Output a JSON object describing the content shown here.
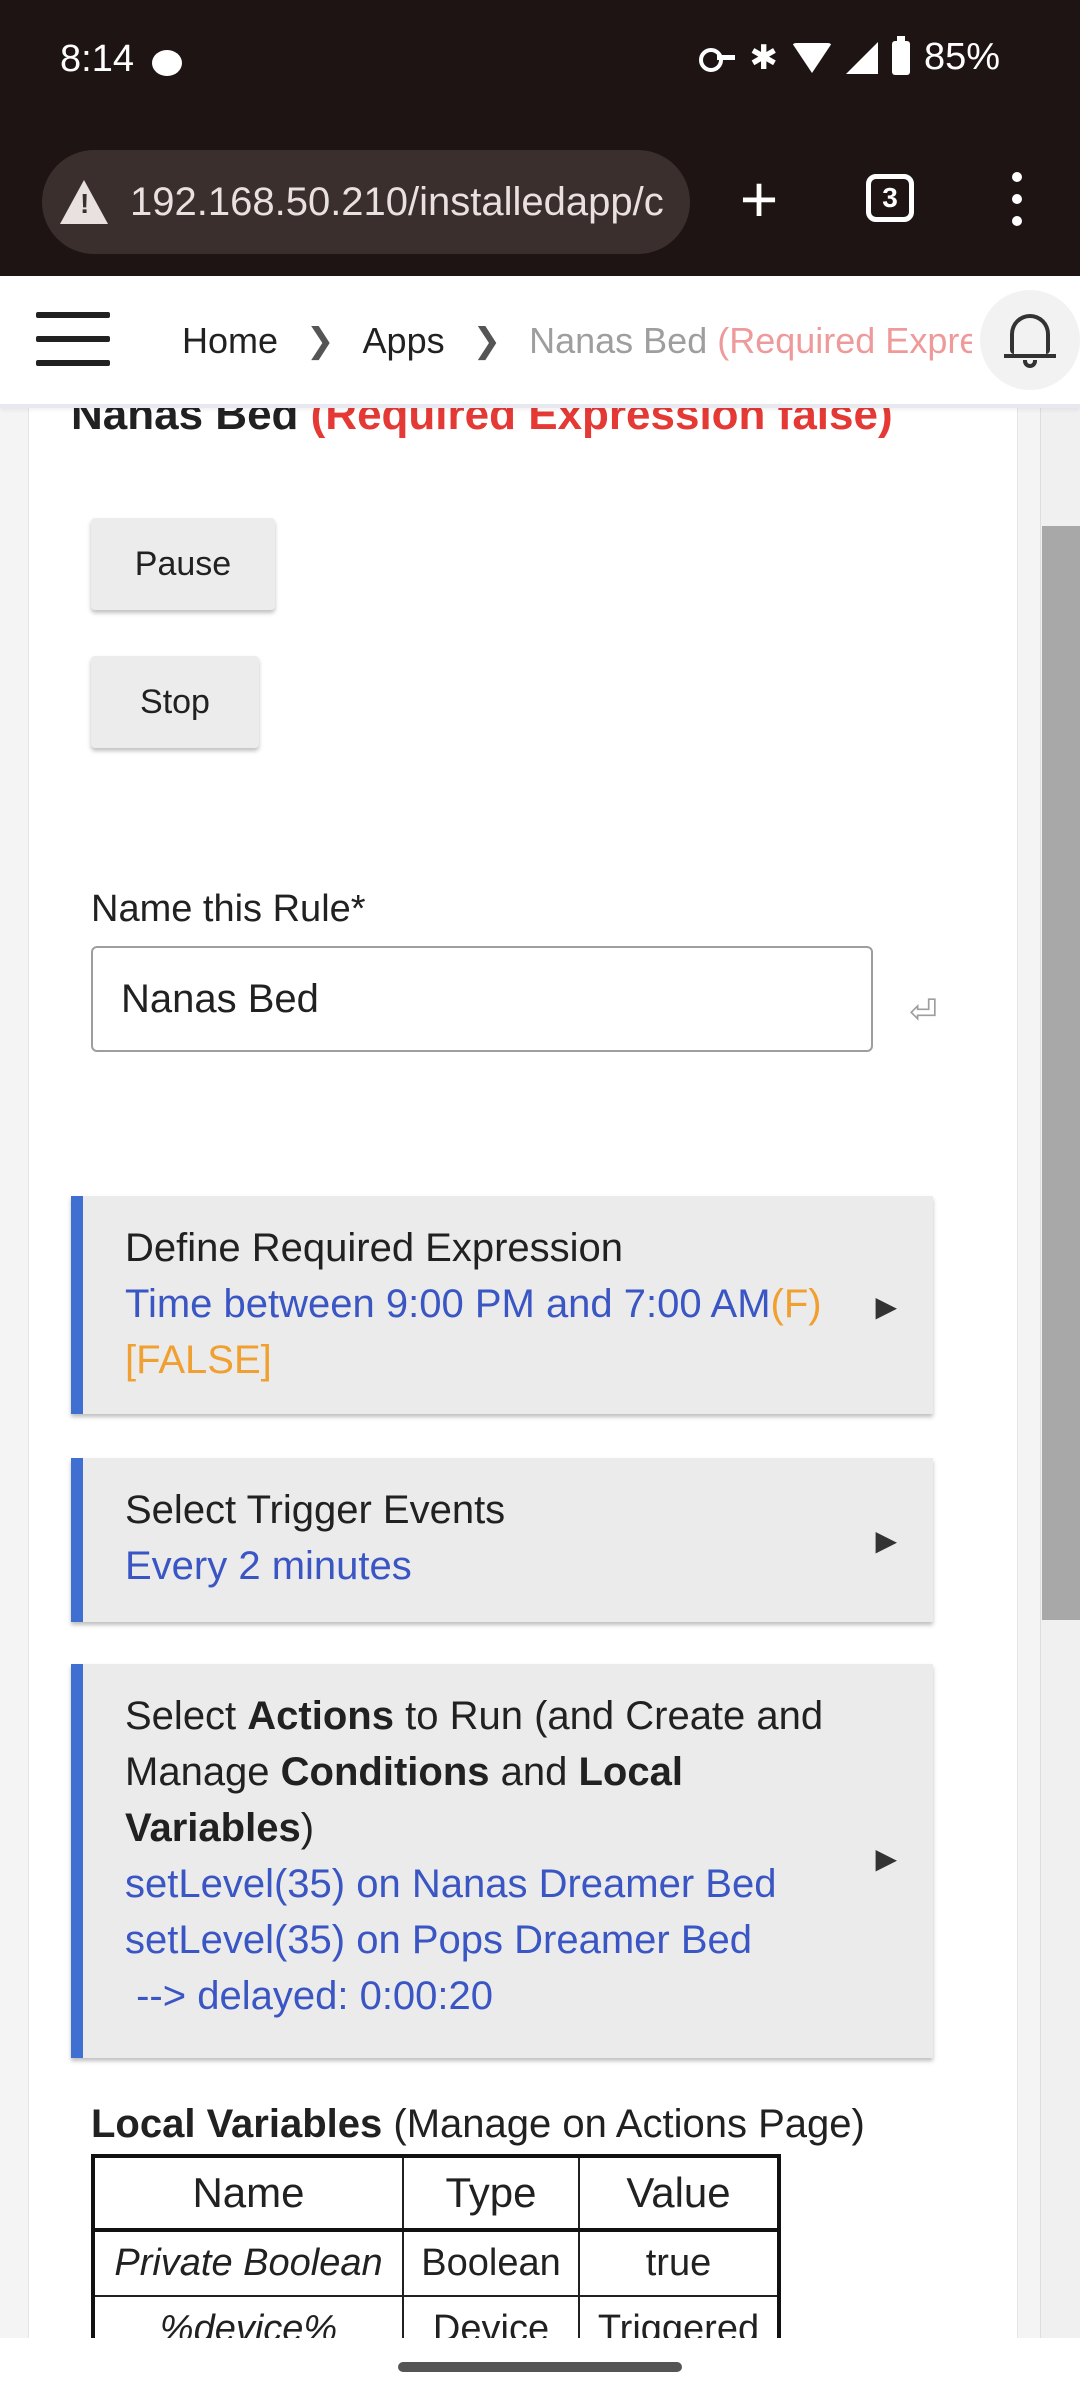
{
  "status_bar": {
    "time": "8:14",
    "battery": "85%"
  },
  "browser": {
    "url": "192.168.50.210/installedapp/c",
    "tab_count": "3"
  },
  "header": {
    "breadcrumbs": [
      {
        "label": "Home"
      },
      {
        "label": "Apps"
      },
      {
        "label": "Nanas Bed",
        "suffix": "(Required Expres"
      }
    ]
  },
  "page": {
    "title": "Nanas Bed",
    "title_status": "(Required Expression false)",
    "pause_label": "Pause",
    "stop_label": "Stop",
    "name_label": "Name this Rule*",
    "name_value": "Nanas Bed",
    "sections": {
      "required_expression": {
        "title": "Define Required Expression",
        "detail": "Time between 9:00 PM and 7:00 AM",
        "flag": "(F)",
        "result": "[FALSE]"
      },
      "trigger_events": {
        "title": "Select Trigger Events",
        "detail": "Every 2 minutes"
      },
      "actions": {
        "title_pre": "Select ",
        "title_b1": "Actions",
        "title_mid": " to Run (and Create and Manage ",
        "title_b2": "Conditions",
        "title_and": " and ",
        "title_b3": "Local Variables",
        "title_post": ")",
        "lines": [
          "setLevel(35) on Nanas Dreamer Bed",
          "setLevel(35) on Pops Dreamer Bed",
          " --> delayed: 0:00:20"
        ]
      }
    },
    "local_variables": {
      "title": "Local Variables",
      "note": " (Manage on Actions Page)",
      "columns": [
        "Name",
        "Type",
        "Value"
      ],
      "rows": [
        [
          "Private Boolean",
          "Boolean",
          "true"
        ],
        [
          "%device%",
          "Device",
          "Triggered"
        ]
      ]
    }
  },
  "colors": {
    "accent_blue": "#3f6fd1",
    "link_blue": "#3a55c4",
    "warning_orange": "#f0a030",
    "error_red": "#e53935"
  }
}
